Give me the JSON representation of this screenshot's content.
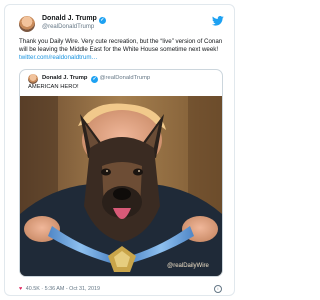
{
  "tweet": {
    "author": {
      "name": "Donald J. Trump",
      "handle": "@realDonaldTrump"
    },
    "text": "Thank you Daily Wire. Very cute recreation, but the “live” version of Conan will be leaving the Middle East for the White House sometime next week!",
    "link": "twitter.com/realdonaldtrum…",
    "quoted": {
      "author": {
        "name": "Donald J. Trump",
        "handle": "@realDonaldTrump"
      },
      "text": "AMERICAN HERO!",
      "watermark": "@realDailyWire"
    },
    "footer": {
      "likes": "40.5K",
      "time": "5:36 AM - Oct 31, 2019"
    }
  },
  "icons": {
    "verified": "verified-badge-icon",
    "platform": "twitter-bird-icon",
    "like": "heart-icon",
    "info": "info-icon"
  },
  "colors": {
    "link": "#1b95e0",
    "verified": "#1da1f2",
    "heart": "#e0245e",
    "text": "#14171a",
    "muted": "#657786"
  }
}
